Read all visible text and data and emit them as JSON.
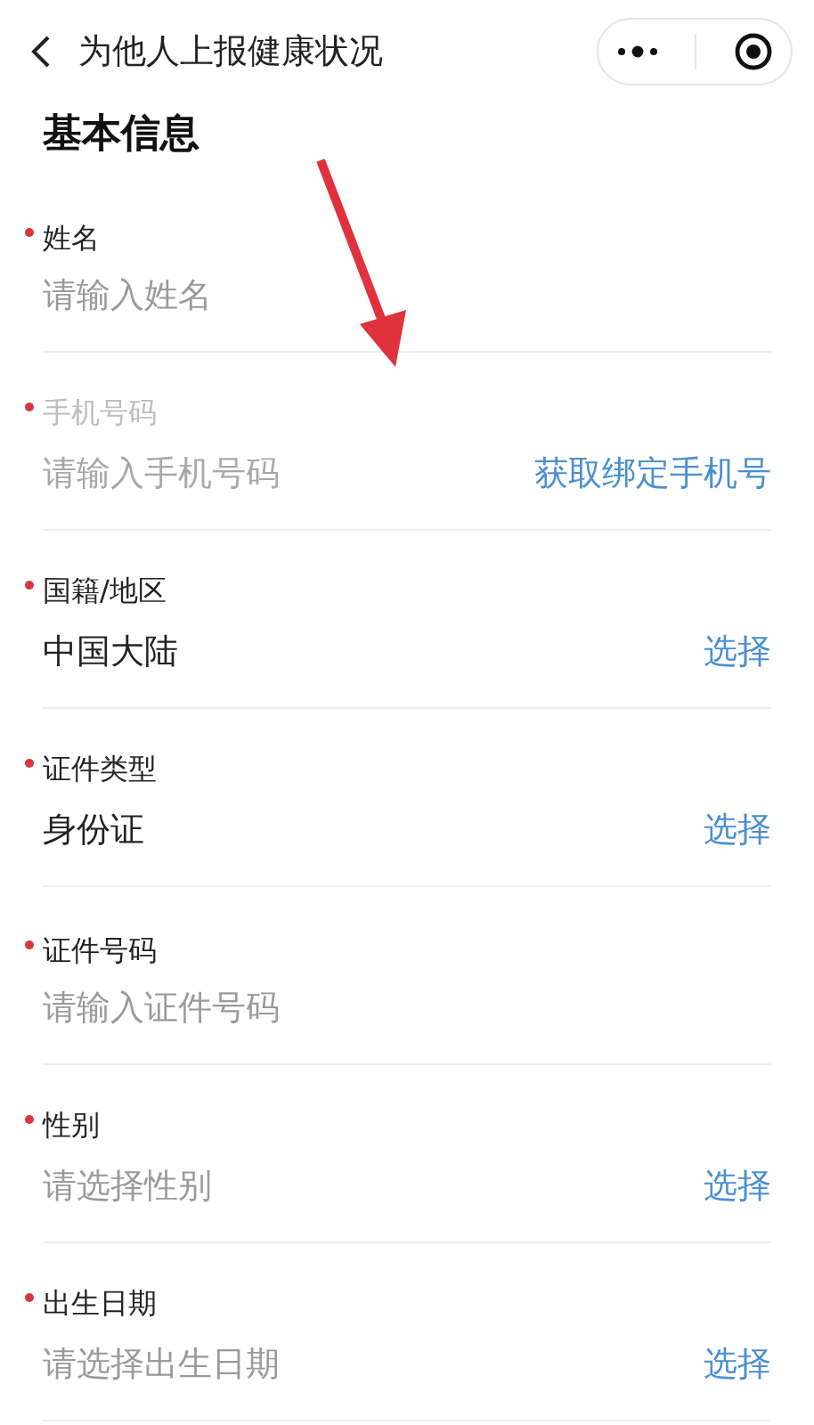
{
  "nav": {
    "title": "为他人上报健康状况"
  },
  "section_title": "基本信息",
  "fields": [
    {
      "label": "姓名",
      "required": true,
      "disabled": false,
      "placeholder": "请输入姓名"
    },
    {
      "label": "手机号码",
      "required": true,
      "disabled": true,
      "placeholder": "请输入手机号码",
      "action": "获取绑定手机号"
    },
    {
      "label": "国籍/地区",
      "required": true,
      "disabled": false,
      "value": "中国大陆",
      "action": "选择"
    },
    {
      "label": "证件类型",
      "required": true,
      "disabled": false,
      "value": "身份证",
      "action": "选择"
    },
    {
      "label": "证件号码",
      "required": true,
      "disabled": false,
      "placeholder": "请输入证件号码"
    },
    {
      "label": "性别",
      "required": true,
      "disabled": false,
      "placeholder": "请选择性别",
      "action": "选择"
    },
    {
      "label": "出生日期",
      "required": true,
      "disabled": false,
      "placeholder": "请选择出生日期",
      "action": "选择"
    }
  ]
}
